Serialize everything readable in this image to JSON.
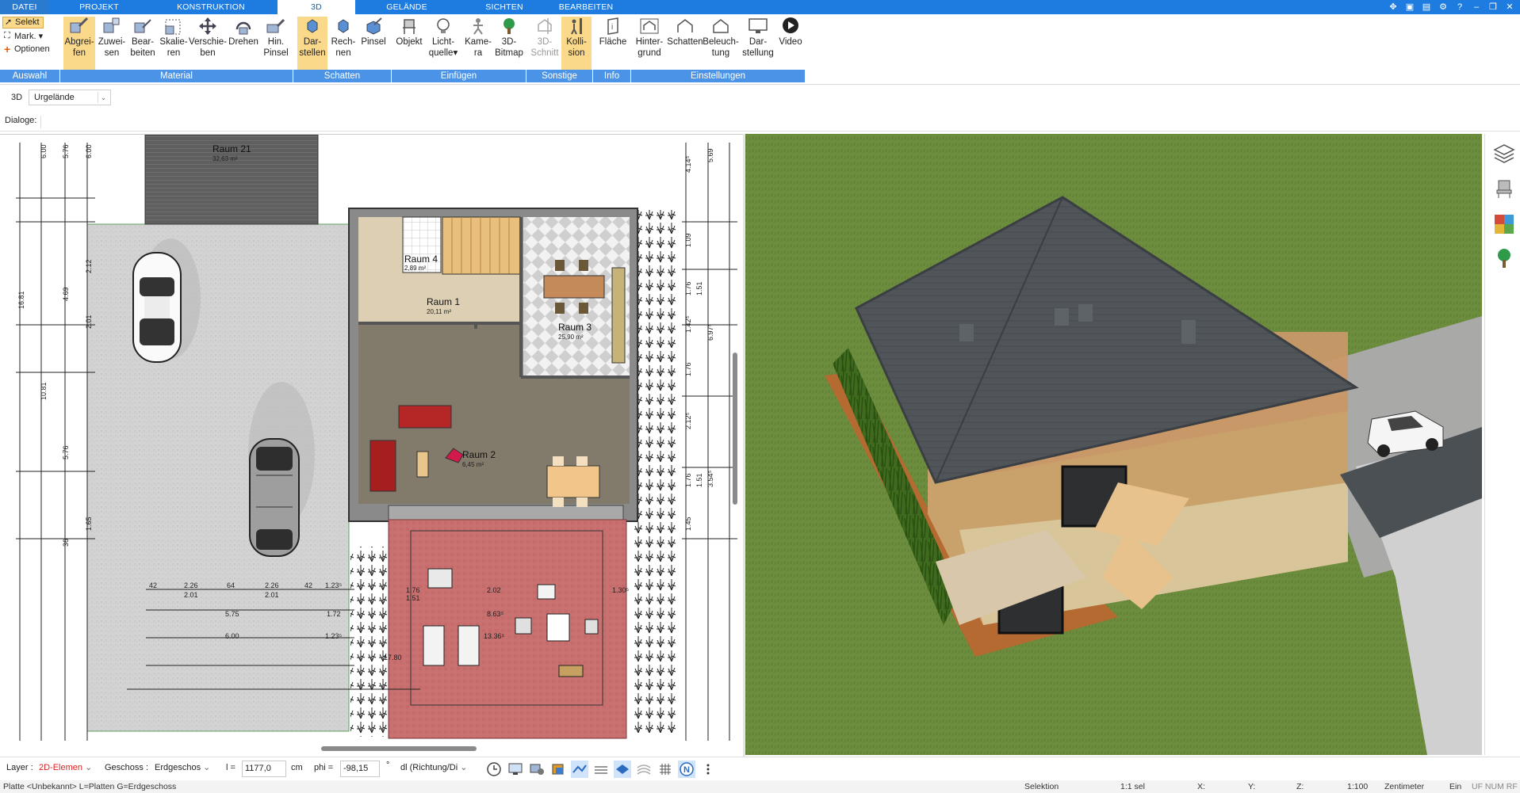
{
  "menu_tabs": [
    "DATEI",
    "PROJEKT",
    "KONSTRUKTION",
    "3D",
    "GELÄNDE",
    "SICHTEN",
    "BEARBEITEN"
  ],
  "ribbon": {
    "auswahl": {
      "select": "Selekt",
      "mark": "Mark.",
      "options": "Optionen"
    },
    "buttons": [
      {
        "label1": "Abgrei-",
        "label2": "fen"
      },
      {
        "label1": "Zuwei-",
        "label2": "sen"
      },
      {
        "label1": "Bear-",
        "label2": "beiten"
      },
      {
        "label1": "Skalie-",
        "label2": "ren"
      },
      {
        "label1": "Verschie-",
        "label2": "ben"
      },
      {
        "label1": "Drehen",
        "label2": ""
      },
      {
        "label1": "Hin.",
        "label2": "Pinsel"
      },
      {
        "label1": "Dar-",
        "label2": "stellen"
      },
      {
        "label1": "Rech-",
        "label2": "nen"
      },
      {
        "label1": "Pinsel",
        "label2": ""
      },
      {
        "label1": "Objekt",
        "label2": ""
      },
      {
        "label1": "Licht-",
        "label2": "quelle"
      },
      {
        "label1": "Kame-",
        "label2": "ra"
      },
      {
        "label1": "3D-",
        "label2": "Bitmap"
      },
      {
        "label1": "3D-",
        "label2": "Schnitt"
      },
      {
        "label1": "Kolli-",
        "label2": "sion"
      },
      {
        "label1": "Fläche",
        "label2": ""
      },
      {
        "label1": "Hinter-",
        "label2": "grund"
      },
      {
        "label1": "Schatten",
        "label2": ""
      },
      {
        "label1": "Beleuch-",
        "label2": "tung"
      },
      {
        "label1": "Dar-",
        "label2": "stellung"
      },
      {
        "label1": "Video",
        "label2": ""
      }
    ],
    "groups": [
      "Auswahl",
      "Material",
      "Schatten",
      "Einfügen",
      "Sonstige",
      "Info",
      "Einstellungen"
    ]
  },
  "view_row": {
    "label": "3D",
    "dropdown": "Urgelände"
  },
  "dialoge_label": "Dialoge:",
  "plan": {
    "rooms": [
      {
        "name": "Raum 21",
        "area": "32,63 m²"
      },
      {
        "name": "Raum 4",
        "area": "2,89 m²"
      },
      {
        "name": "Raum 1",
        "area": "20,11 m²"
      },
      {
        "name": "Raum 3",
        "area": "25,90 m²"
      },
      {
        "name": "Raum 2",
        "area": "6,45 m²"
      }
    ],
    "dims_left": [
      "6.00",
      "5.76",
      "6.00",
      "16.81",
      "4.69",
      "2.12",
      "2.01",
      "10.81",
      "5.76",
      "1.65",
      "36"
    ],
    "dims_right": [
      "4.14⁵",
      "5.69",
      "1.09",
      "1.76",
      "1.51",
      "1.42⁵",
      "6.97⁵",
      "1.76",
      "2.12⁵",
      "1.76",
      "3.54⁵",
      "1.45",
      "1.51"
    ],
    "dims_bottom": [
      "42",
      "2.26",
      "64",
      "2.26",
      "42",
      "1.23⁵",
      "2.01",
      "2.01",
      "5.75",
      "1.72",
      "6.00",
      "1.23⁵",
      "1.76",
      "2.02",
      "1.51",
      "8.63⁵",
      "13.36⁵",
      "17.80",
      "1.30⁵"
    ]
  },
  "bottombar": {
    "layer_label": "Layer :",
    "layer_value": "2D-Elemen",
    "geschoss_label": "Geschoss :",
    "geschoss_value": "Erdgeschos",
    "l_label": "l =",
    "l_value": "1177,0",
    "l_unit": "cm",
    "phi_label": "phi =",
    "phi_value": "-98,15",
    "phi_unit": "°",
    "dl_value": "dl (Richtung/Di"
  },
  "status": {
    "left": "Platte <Unbekannt> L=Platten G=Erdgeschoss",
    "mode": "Selektion",
    "sel": "1:1 sel",
    "x": "X:",
    "y": "Y:",
    "z": "Z:",
    "scale": "1:100",
    "unit": "Zentimeter",
    "ein": "Ein",
    "flags": "UF  NUM  RF"
  },
  "colors": {
    "accent": "#1e7be0",
    "ribbon_group": "#4b93e6",
    "active_button": "#fbd98a",
    "grass": "#6f8f43",
    "roof": "#4f5458"
  }
}
